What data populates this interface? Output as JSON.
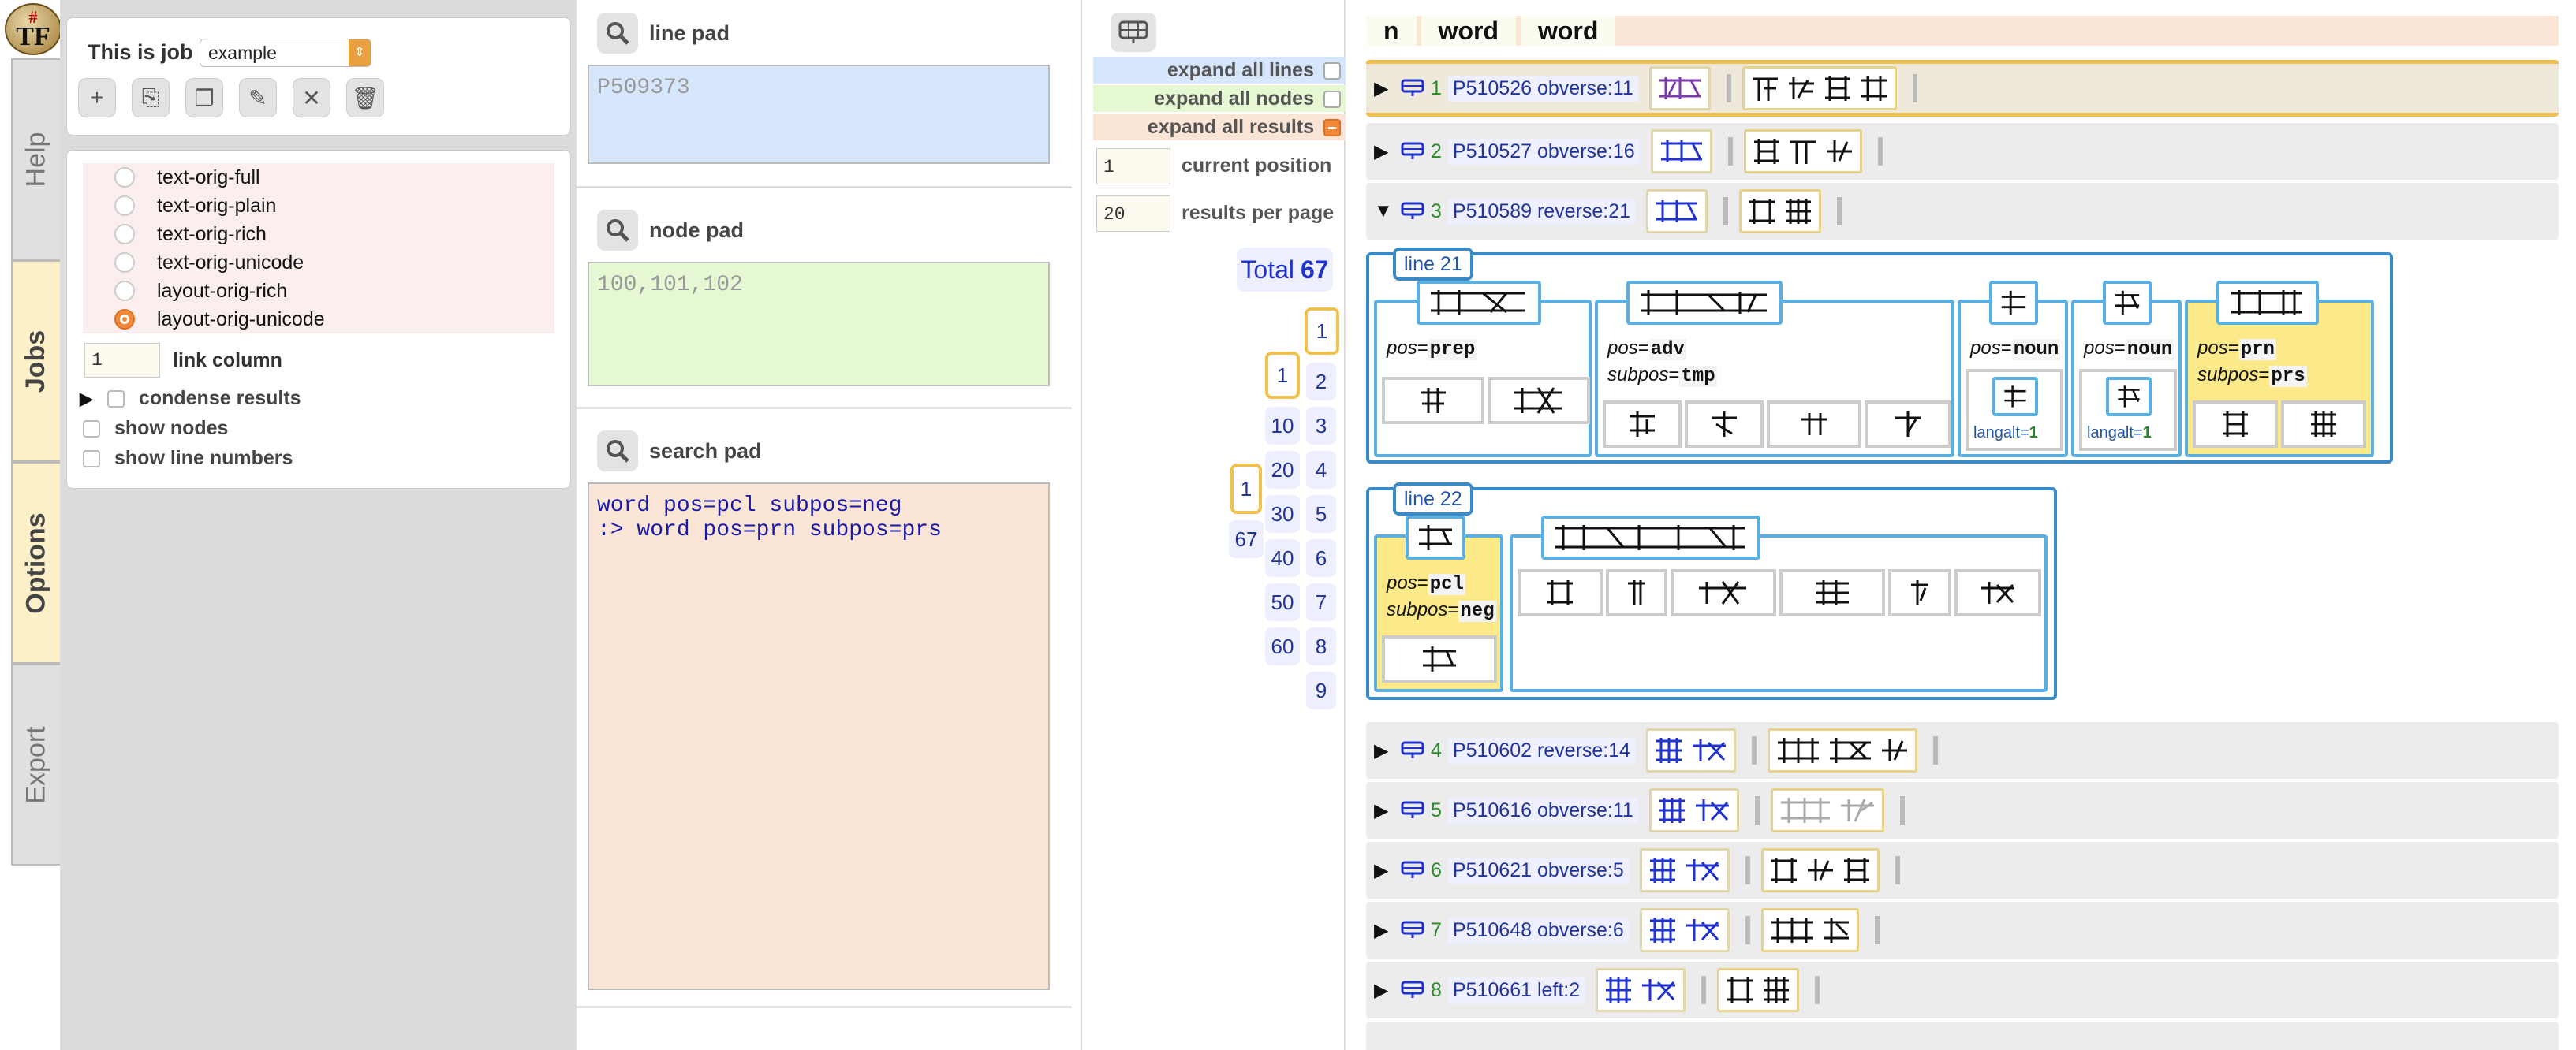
{
  "app": {
    "logo_hash": "#",
    "logo_text": "TF"
  },
  "tabs": [
    "Help",
    "Jobs",
    "Options",
    "Export"
  ],
  "job": {
    "label": "This is job",
    "selected": "example"
  },
  "formats": [
    {
      "label": "text-orig-full",
      "checked": false
    },
    {
      "label": "text-orig-plain",
      "checked": false
    },
    {
      "label": "text-orig-rich",
      "checked": false
    },
    {
      "label": "text-orig-unicode",
      "checked": false
    },
    {
      "label": "layout-orig-rich",
      "checked": false
    },
    {
      "label": "layout-orig-unicode",
      "checked": true
    }
  ],
  "link_column": {
    "value": "1",
    "label": "link column"
  },
  "options": {
    "condense": "condense results",
    "show_nodes": "show nodes",
    "show_line_numbers": "show line numbers"
  },
  "pads": {
    "line": {
      "title": "line pad",
      "value": "P509373"
    },
    "node": {
      "title": "node pad",
      "value": "100,101,102"
    },
    "search": {
      "title": "search pad",
      "value": "word pos=pcl subpos=neg\n:> word pos=prn subpos=prs"
    }
  },
  "nav": {
    "expand_lines": "expand all lines",
    "expand_nodes": "expand all nodes",
    "expand_results": "expand all results",
    "current_position": {
      "value": "1",
      "label": "current position"
    },
    "results_per_page": {
      "value": "20",
      "label": "results per page"
    },
    "total_label": "Total",
    "total": "67",
    "pages_right": [
      "1",
      "2",
      "3",
      "4",
      "5",
      "6",
      "7",
      "8",
      "9"
    ],
    "pages_mid": [
      "1",
      "10",
      "20",
      "30",
      "40",
      "50",
      "60"
    ],
    "pages_left": [
      "1",
      "67"
    ]
  },
  "results": {
    "columns": [
      "n",
      "word",
      "word"
    ],
    "rows": [
      {
        "n": "1",
        "ref": "P510526 obverse:11"
      },
      {
        "n": "2",
        "ref": "P510527 obverse:16"
      },
      {
        "n": "3",
        "ref": "P510589 reverse:21"
      },
      {
        "n": "4",
        "ref": "P510602 reverse:14"
      },
      {
        "n": "5",
        "ref": "P510616 obverse:11"
      },
      {
        "n": "6",
        "ref": "P510621 obverse:5"
      },
      {
        "n": "7",
        "ref": "P510648 obverse:6"
      },
      {
        "n": "8",
        "ref": "P510661 left:2"
      }
    ],
    "expanded": {
      "line21": "line 21",
      "line22": "line 22",
      "words": [
        {
          "pos_key": "pos",
          "pos": "prep"
        },
        {
          "pos_key": "pos",
          "pos": "adv",
          "sub_key": "subpos",
          "subpos": "tmp"
        },
        {
          "pos_key": "pos",
          "pos": "noun",
          "langalt_key": "langalt",
          "langalt": "1"
        },
        {
          "pos_key": "pos",
          "pos": "noun",
          "langalt_key": "langalt",
          "langalt": "1"
        },
        {
          "pos_key": "pos",
          "pos": "prn",
          "sub_key": "subpos",
          "subpos": "prs"
        },
        {
          "pos_key": "pos",
          "pos": "pcl",
          "sub_key": "subpos",
          "subpos": "neg"
        }
      ]
    }
  },
  "colors": {
    "accent": "#f0c050",
    "link": "#2233cc",
    "line_border": "#3a8ac8"
  }
}
